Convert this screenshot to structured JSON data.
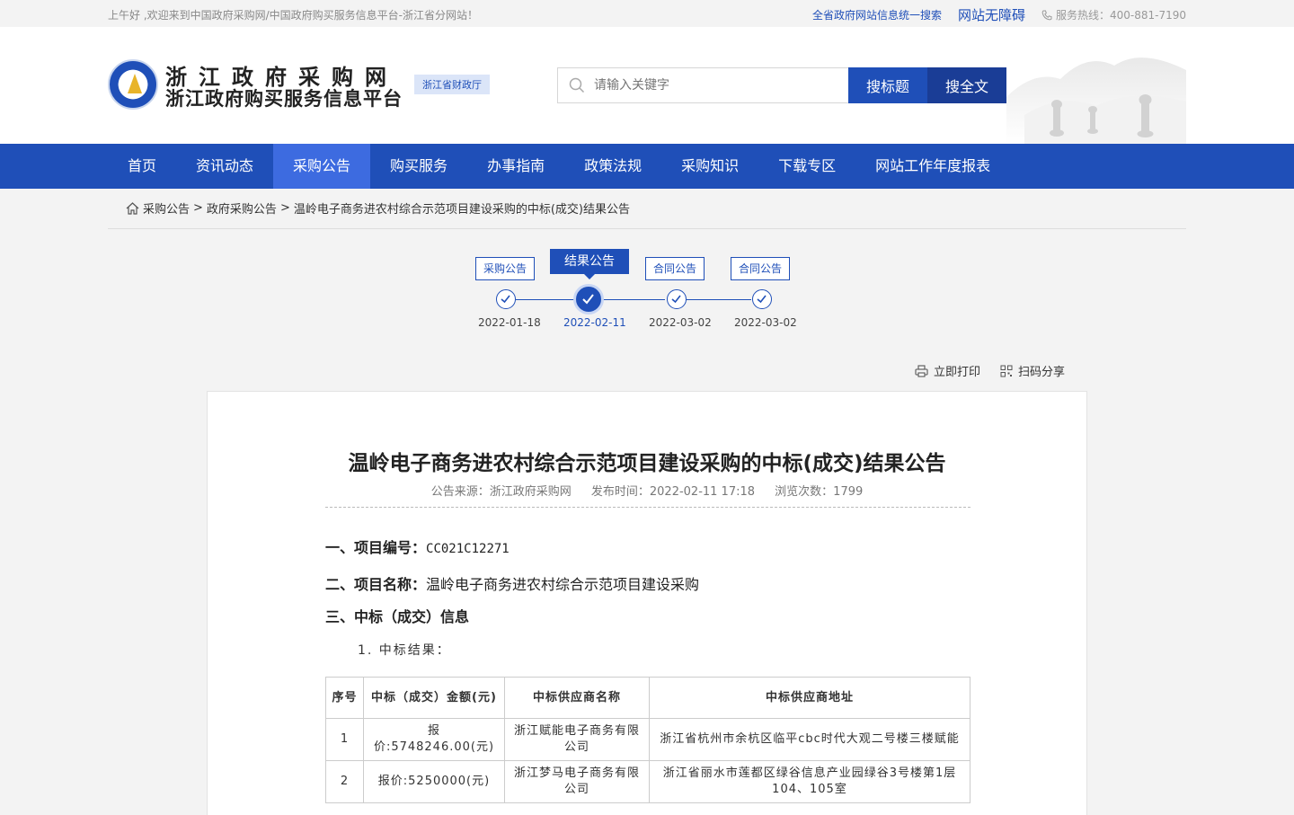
{
  "topbar": {
    "greeting": "上午好 ,欢迎来到中国政府采购网/中国政府购买服务信息平台-浙江省分网站！",
    "unified_search": "全省政府网站信息统一搜索",
    "accessibility": "网站无障碍",
    "hotline": "服务热线：400-881-7190"
  },
  "header": {
    "title_line1": "浙江政府采购网",
    "title_line2": "浙江政府购买服务信息平台",
    "dept_badge": "浙江省财政厅",
    "search_placeholder": "请输入关键字",
    "search_title_button": "搜标题",
    "search_full_button": "搜全文"
  },
  "nav": {
    "items": [
      {
        "label": "首页"
      },
      {
        "label": "资讯动态"
      },
      {
        "label": "采购公告"
      },
      {
        "label": "购买服务"
      },
      {
        "label": "办事指南"
      },
      {
        "label": "政策法规"
      },
      {
        "label": "采购知识"
      },
      {
        "label": "下载专区"
      },
      {
        "label": "网站工作年度报表"
      }
    ],
    "active_index": 2
  },
  "breadcrumb": {
    "items": [
      "采购公告",
      "政府采购公告",
      "温岭电子商务进农村综合示范项目建设采购的中标(成交)结果公告"
    ],
    "separator": ">"
  },
  "timeline": {
    "steps": [
      {
        "label": "采购公告",
        "date": "2022-01-18"
      },
      {
        "label": "结果公告",
        "date": "2022-02-11"
      },
      {
        "label": "合同公告",
        "date": "2022-03-02"
      },
      {
        "label": "合同公告",
        "date": "2022-03-02"
      }
    ],
    "active_index": 1
  },
  "tools": {
    "print": "立即打印",
    "share": "扫码分享"
  },
  "article": {
    "title": "温岭电子商务进农村综合示范项目建设采购的中标(成交)结果公告",
    "source": "公告来源：浙江政府采购网",
    "publish_time": "发布时间：2022-02-11 17:18",
    "views": "浏览次数：1799",
    "section1_label": "一、项目编号：",
    "section1_value": "CC021C12271",
    "section2_label": "二、项目名称：",
    "section2_value": "温岭电子商务进农村综合示范项目建设采购",
    "section3_label": "三、中标（成交）信息",
    "subheading": "1. 中标结果：",
    "table": {
      "headers": [
        "序号",
        "中标（成交）金额(元)",
        "中标供应商名称",
        "中标供应商地址"
      ],
      "rows": [
        [
          "1",
          "报价:5748246.00(元)",
          "浙江赋能电子商务有限公司",
          "浙江省杭州市余杭区临平cbc时代大观二号楼三楼赋能"
        ],
        [
          "2",
          "报价:5250000(元)",
          "浙江梦马电子商务有限公司",
          "浙江省丽水市莲都区绿谷信息产业园绿谷3号楼第1层104、105室"
        ]
      ]
    }
  },
  "colors": {
    "primary": "#1f4fb8",
    "nav_active": "#3d6be0",
    "page_bg": "#f3f3f3"
  },
  "icons": [
    "search-icon",
    "phone-icon",
    "home-icon",
    "check-icon",
    "printer-icon",
    "qrcode-icon"
  ]
}
